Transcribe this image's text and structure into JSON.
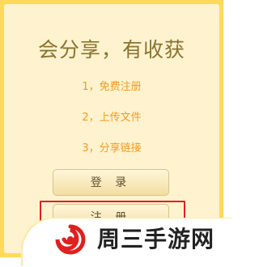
{
  "header": {
    "title": "会分享，有收获"
  },
  "features": [
    "1，免费注册",
    "2，上传文件",
    "3，分享链接"
  ],
  "buttons": {
    "login_label": "登 录",
    "register_label": "注 册"
  },
  "watermark": {
    "text": "周三手游网"
  },
  "colors": {
    "frame": "#ffd95a",
    "panel": "#fff3cf",
    "title": "#8a7330",
    "feature": "#f39a1f",
    "highlight": "#e0201e",
    "logo_red": "#e0201e"
  }
}
